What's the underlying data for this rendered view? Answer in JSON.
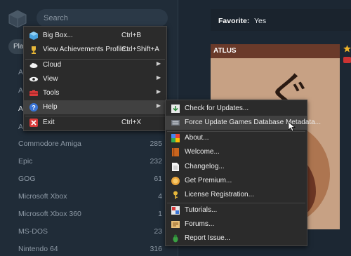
{
  "search": {
    "placeholder": "Search"
  },
  "platform_pill": {
    "label": "Pla"
  },
  "sidebar": {
    "items": [
      {
        "name": "All",
        "count": ""
      },
      {
        "name": "An",
        "count": ""
      },
      {
        "name": "An",
        "count": ""
      },
      {
        "name": "At",
        "count": ""
      },
      {
        "name": "Commodore Amiga",
        "count": "285"
      },
      {
        "name": "Epic",
        "count": "232"
      },
      {
        "name": "GOG",
        "count": "61"
      },
      {
        "name": "Microsoft Xbox",
        "count": "4"
      },
      {
        "name": "Microsoft Xbox 360",
        "count": "1"
      },
      {
        "name": "MS-DOS",
        "count": "23"
      },
      {
        "name": "Nintendo 64",
        "count": "316"
      }
    ]
  },
  "favorite": {
    "label": "Favorite:",
    "value": "Yes"
  },
  "cover": {
    "brand": "ATLUS",
    "glyph": "ぐ"
  },
  "menu": {
    "items": [
      {
        "label": "Big Box...",
        "shortcut": "Ctrl+B",
        "icon": "bigbox-icon"
      },
      {
        "label": "View Achievements Profile...",
        "shortcut": "Ctrl+Shift+A",
        "icon": "trophy-icon"
      },
      {
        "label": "Cloud",
        "icon": "cloud-icon"
      },
      {
        "label": "View",
        "icon": "eye-icon"
      },
      {
        "label": "Tools",
        "icon": "tools-icon"
      },
      {
        "label": "Help",
        "icon": "help-icon"
      },
      {
        "label": "Exit",
        "shortcut": "Ctrl+X",
        "icon": "exit-icon"
      }
    ]
  },
  "help_menu": {
    "items": [
      {
        "label": "Check for Updates...",
        "icon": "download-icon"
      },
      {
        "label": "Force Update Games Database Metadata...",
        "icon": "database-icon"
      },
      {
        "label": "About...",
        "icon": "info-icon"
      },
      {
        "label": "Welcome...",
        "icon": "book-icon"
      },
      {
        "label": "Changelog...",
        "icon": "document-icon"
      },
      {
        "label": "Get Premium...",
        "icon": "premium-icon"
      },
      {
        "label": "License Registration...",
        "icon": "key-icon"
      },
      {
        "label": "Tutorials...",
        "icon": "tutorial-icon"
      },
      {
        "label": "Forums...",
        "icon": "forum-icon"
      },
      {
        "label": "Report Issue...",
        "icon": "bug-icon"
      }
    ]
  }
}
